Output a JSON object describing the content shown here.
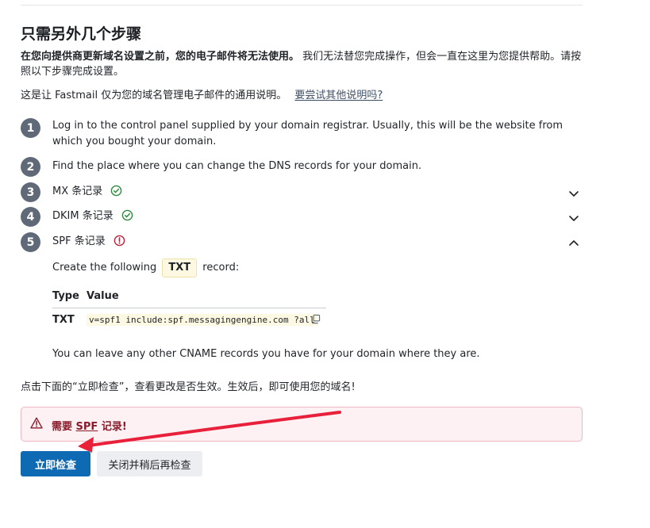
{
  "header": {
    "title": "只需另外几个步骤"
  },
  "intro": {
    "bold": "在您向提供商更新域名设置之前，您的电子邮件将无法使用。",
    "rest": " 我们无法替您完成操作，但会一直在这里为您提供帮助。请按照以下步骤完成设置。"
  },
  "generic": {
    "text": "这是让 Fastmail 仅为您的域名管理电子邮件的通用说明。",
    "link": "要尝试其他说明吗?"
  },
  "steps": [
    {
      "num": "1",
      "text": "Log in to the control panel supplied by your domain registrar. Usually, this will be the website from which you bought your domain."
    },
    {
      "num": "2",
      "text": "Find the place where you can change the DNS records for your domain."
    },
    {
      "num": "3",
      "label": "MX 条记录",
      "status": "check-circle-icon"
    },
    {
      "num": "4",
      "label": "DKIM 条记录",
      "status": "check-circle-icon"
    },
    {
      "num": "5",
      "label": "SPF 条记录",
      "status": "alert-circle-icon"
    }
  ],
  "spf": {
    "create_prefix": "Create the following",
    "badge": "TXT",
    "create_suffix": "record:",
    "col_type": "Type",
    "col_value": "Value",
    "row_type": "TXT",
    "row_value": "v=spf1 include:spf.messagingengine.com ?all",
    "note": "You can leave any other CNAME records you have for your domain where they are."
  },
  "check_hint": "点击下面的“立即检查”，查看更改是否生效。生效后，即可使用您的域名!",
  "alert": {
    "prefix": "需要 ",
    "link": "SPF",
    "suffix": " 记录!"
  },
  "buttons": {
    "check_now": "立即检查",
    "close_later": "关闭并稍后再检查"
  },
  "colors": {
    "primary": "#0f6ab4",
    "ok": "#2d8a3e",
    "error": "#b4233a",
    "annotation_arrow": "#e8203a"
  }
}
